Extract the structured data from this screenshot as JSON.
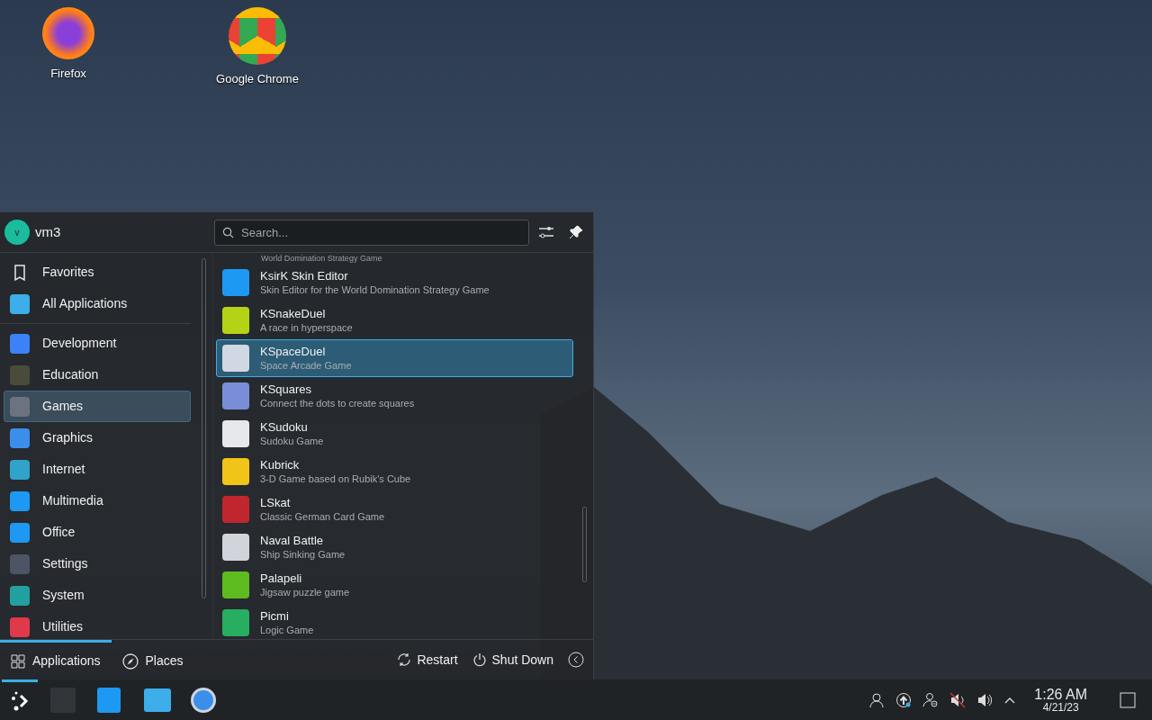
{
  "desktop_icons": [
    {
      "label": "Firefox"
    },
    {
      "label": "Google Chrome"
    }
  ],
  "menu": {
    "user": {
      "initial": "v",
      "name": "vm3"
    },
    "search": {
      "placeholder": "Search..."
    },
    "categories": [
      {
        "label": "Favorites",
        "selected": false
      },
      {
        "label": "All Applications",
        "selected": false
      },
      {
        "label": "Development",
        "selected": false
      },
      {
        "label": "Education",
        "selected": false
      },
      {
        "label": "Games",
        "selected": true
      },
      {
        "label": "Graphics",
        "selected": false
      },
      {
        "label": "Internet",
        "selected": false
      },
      {
        "label": "Multimedia",
        "selected": false
      },
      {
        "label": "Office",
        "selected": false
      },
      {
        "label": "Settings",
        "selected": false
      },
      {
        "label": "System",
        "selected": false
      },
      {
        "label": "Utilities",
        "selected": false
      }
    ],
    "cut_subtitle": "World Domination Strategy Game",
    "apps": [
      {
        "name": "KsirK Skin Editor",
        "description": "Skin Editor for the World Domination Strategy Game",
        "selected": false
      },
      {
        "name": "KSnakeDuel",
        "description": "A race in hyperspace",
        "selected": false
      },
      {
        "name": "KSpaceDuel",
        "description": "Space Arcade Game",
        "selected": true
      },
      {
        "name": "KSquares",
        "description": "Connect the dots to create squares",
        "selected": false
      },
      {
        "name": "KSudoku",
        "description": "Sudoku Game",
        "selected": false
      },
      {
        "name": "Kubrick",
        "description": "3-D Game based on Rubik's Cube",
        "selected": false
      },
      {
        "name": "LSkat",
        "description": "Classic German Card Game",
        "selected": false
      },
      {
        "name": "Naval Battle",
        "description": "Ship Sinking Game",
        "selected": false
      },
      {
        "name": "Palapeli",
        "description": "Jigsaw puzzle game",
        "selected": false
      },
      {
        "name": "Picmi",
        "description": "Logic Game",
        "selected": false
      }
    ],
    "tabs": [
      {
        "label": "Applications",
        "selected": true
      },
      {
        "label": "Places",
        "selected": false
      }
    ],
    "actions": [
      {
        "label": "Restart"
      },
      {
        "label": "Shut Down"
      }
    ]
  },
  "clock": {
    "time": "1:26 AM",
    "date": "4/21/23"
  }
}
